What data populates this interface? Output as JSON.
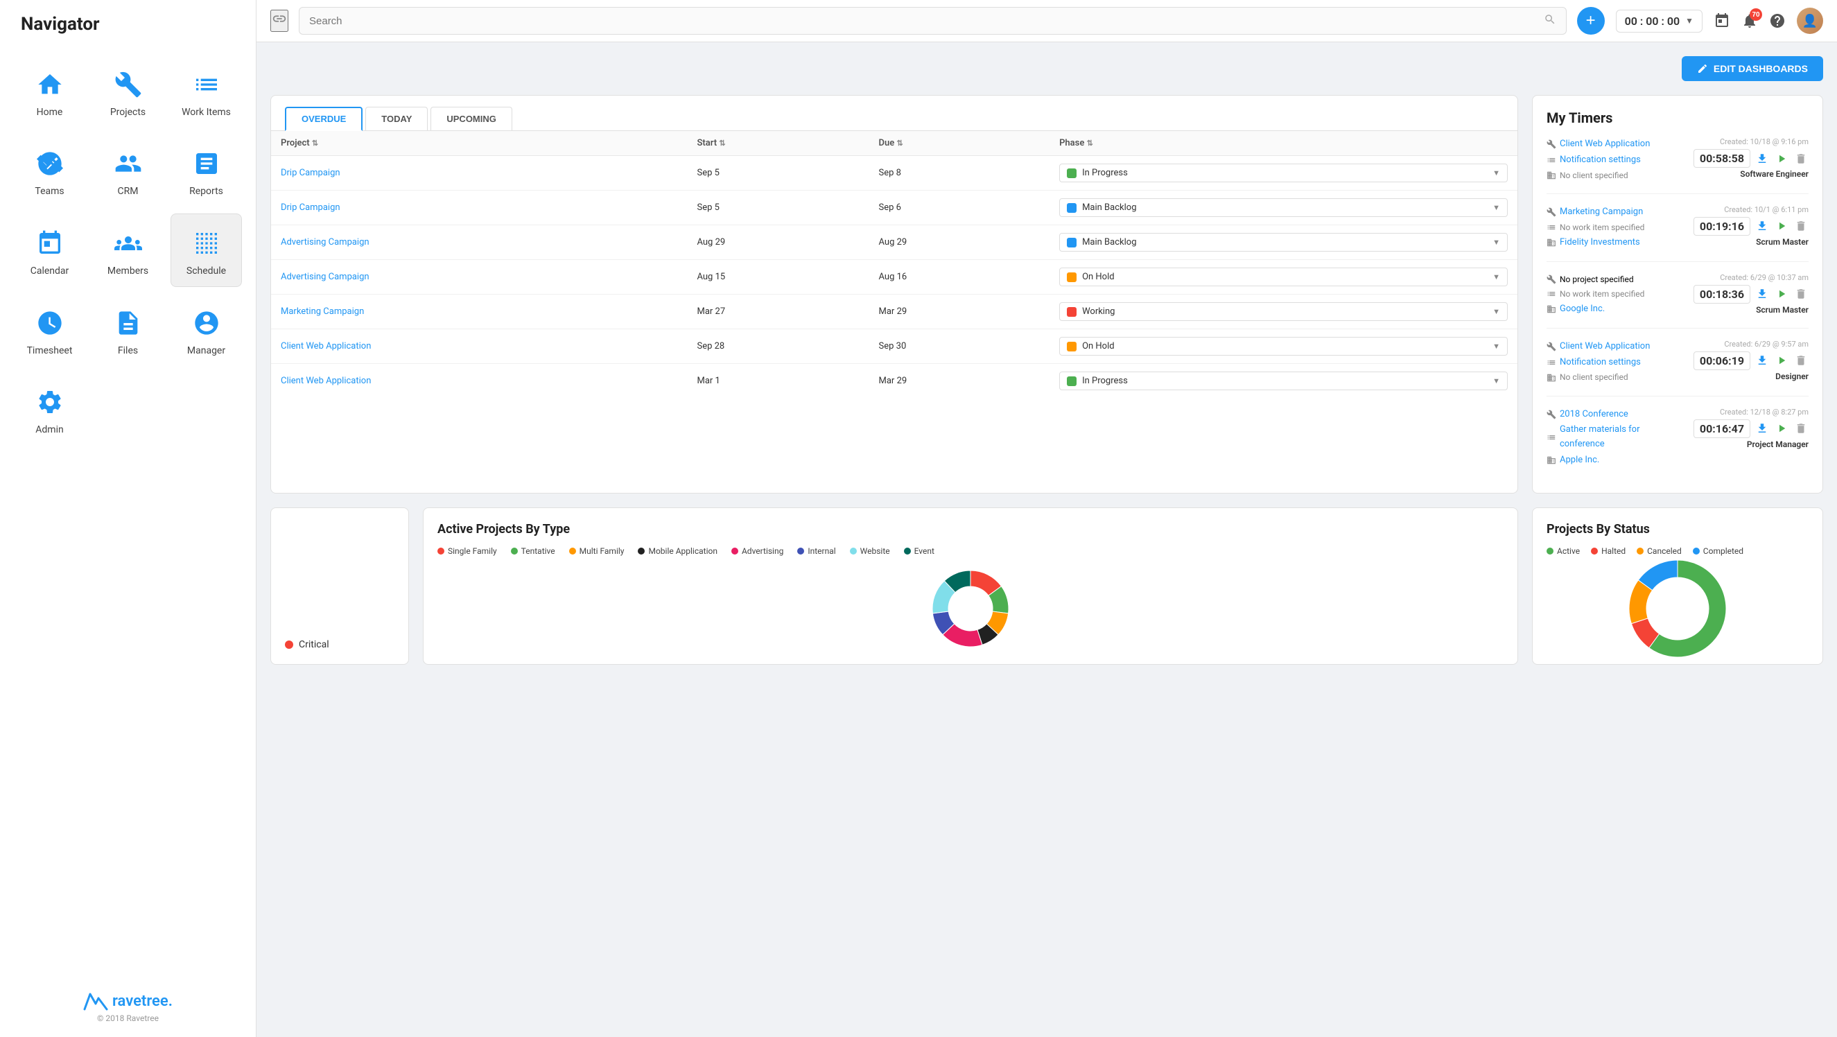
{
  "sidebar": {
    "title": "Navigator",
    "nav_items": [
      {
        "id": "home",
        "label": "Home",
        "icon": "home"
      },
      {
        "id": "projects",
        "label": "Projects",
        "icon": "projects"
      },
      {
        "id": "work-items",
        "label": "Work Items",
        "icon": "work-items"
      },
      {
        "id": "teams",
        "label": "Teams",
        "icon": "teams"
      },
      {
        "id": "crm",
        "label": "CRM",
        "icon": "crm"
      },
      {
        "id": "reports",
        "label": "Reports",
        "icon": "reports"
      },
      {
        "id": "calendar",
        "label": "Calendar",
        "icon": "calendar"
      },
      {
        "id": "members",
        "label": "Members",
        "icon": "members"
      },
      {
        "id": "schedule",
        "label": "Schedule",
        "icon": "schedule"
      },
      {
        "id": "timesheet",
        "label": "Timesheet",
        "icon": "timesheet"
      },
      {
        "id": "files",
        "label": "Files",
        "icon": "files"
      },
      {
        "id": "manager",
        "label": "Manager",
        "icon": "manager"
      },
      {
        "id": "admin",
        "label": "Admin",
        "icon": "admin"
      }
    ],
    "logo": "ravetree.",
    "copyright": "© 2018 Ravetree"
  },
  "topbar": {
    "search_placeholder": "Search",
    "timer_value": "00 : 00 : 00",
    "notification_count": "70",
    "edit_dashboards_label": "EDIT DASHBOARDS"
  },
  "work_items": {
    "tabs": [
      "OVERDUE",
      "TODAY",
      "UPCOMING"
    ],
    "active_tab": "OVERDUE",
    "columns": [
      "Project",
      "Start",
      "Due",
      "Phase"
    ],
    "rows": [
      {
        "project": "Drip Campaign",
        "start": "Sep 5",
        "due": "Sep 8",
        "phase": "In Progress",
        "phase_color": "#4caf50"
      },
      {
        "project": "Drip Campaign",
        "start": "Sep 5",
        "due": "Sep 6",
        "phase": "Main Backlog",
        "phase_color": "#2196f3"
      },
      {
        "project": "Advertising Campaign",
        "start": "Aug 29",
        "due": "Aug 29",
        "phase": "Main Backlog",
        "phase_color": "#2196f3"
      },
      {
        "project": "Advertising Campaign",
        "start": "Aug 15",
        "due": "Aug 16",
        "phase": "On Hold",
        "phase_color": "#ff9800"
      },
      {
        "project": "Marketing Campaign",
        "start": "Mar 27",
        "due": "Mar 29",
        "phase": "Working",
        "phase_color": "#f44336"
      },
      {
        "project": "Client Web Application",
        "start": "Sep 28",
        "due": "Sep 30",
        "phase": "On Hold",
        "phase_color": "#ff9800"
      },
      {
        "project": "Client Web Application",
        "start": "Mar 1",
        "due": "Mar 29",
        "phase": "In Progress",
        "phase_color": "#4caf50"
      }
    ]
  },
  "my_timers": {
    "title": "My Timers",
    "timers": [
      {
        "project": "Client Web Application",
        "work_item": "Notification settings",
        "client": "No client specified",
        "created": "Created: 10/18 @ 9:16 pm",
        "time": "00:58:58",
        "role": "Software Engineer"
      },
      {
        "project": "Marketing Campaign",
        "work_item": "No work item specified",
        "client": "Fidelity Investments",
        "created": "Created: 10/1 @ 6:11 pm",
        "time": "00:19:16",
        "role": "Scrum Master"
      },
      {
        "project": "No project specified",
        "work_item": "No work item specified",
        "client": "Google Inc.",
        "created": "Created: 6/29 @ 10:37 am",
        "time": "00:18:36",
        "role": "Scrum Master"
      },
      {
        "project": "Client Web Application",
        "work_item": "Notification settings",
        "client": "No client specified",
        "created": "Created: 6/29 @ 9:57 am",
        "time": "00:06:19",
        "role": "Designer"
      },
      {
        "project": "2018 Conference",
        "work_item": "Gather materials for conference",
        "client": "Apple Inc.",
        "created": "Created: 12/18 @ 8:27 pm",
        "time": "00:16:47",
        "role": "Project Manager"
      }
    ]
  },
  "active_projects_chart": {
    "title": "Active Projects By Type",
    "legend": [
      {
        "label": "Single Family",
        "color": "#f44336"
      },
      {
        "label": "Tentative",
        "color": "#4caf50"
      },
      {
        "label": "Multi Family",
        "color": "#ff9800"
      },
      {
        "label": "Mobile Application",
        "color": "#212121"
      },
      {
        "label": "Advertising",
        "color": "#e91e63"
      },
      {
        "label": "Internal",
        "color": "#3f51b5"
      },
      {
        "label": "Website",
        "color": "#80deea"
      },
      {
        "label": "Event",
        "color": "#00695c"
      }
    ],
    "donut_segments": [
      {
        "color": "#f44336",
        "value": 15
      },
      {
        "color": "#4caf50",
        "value": 12
      },
      {
        "color": "#ff9800",
        "value": 10
      },
      {
        "color": "#212121",
        "value": 8
      },
      {
        "color": "#e91e63",
        "value": 18
      },
      {
        "color": "#3f51b5",
        "value": 10
      },
      {
        "color": "#80deea",
        "value": 15
      },
      {
        "color": "#00695c",
        "value": 12
      }
    ]
  },
  "projects_by_status": {
    "title": "Projects By Status",
    "legend": [
      {
        "label": "Active",
        "color": "#4caf50"
      },
      {
        "label": "Halted",
        "color": "#f44336"
      },
      {
        "label": "Canceled",
        "color": "#ff9800"
      },
      {
        "label": "Completed",
        "color": "#2196f3"
      }
    ],
    "donut_segments": [
      {
        "color": "#4caf50",
        "value": 60
      },
      {
        "color": "#f44336",
        "value": 10
      },
      {
        "color": "#ff9800",
        "value": 15
      },
      {
        "color": "#2196f3",
        "value": 15
      }
    ]
  },
  "critical_label": "Critical"
}
